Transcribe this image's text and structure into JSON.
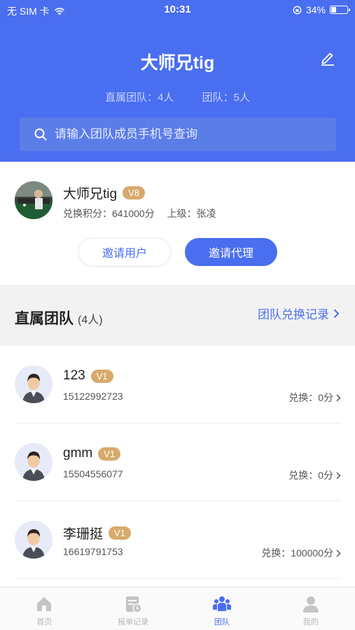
{
  "status_bar": {
    "carrier": "无 SIM 卡",
    "time": "10:31",
    "battery": "34%",
    "battery_level": 0.34
  },
  "header": {
    "title": "大师兄tig",
    "direct_team": "直属团队：4人",
    "team": "团队：5人"
  },
  "search": {
    "placeholder": "请输入团队成员手机号查询"
  },
  "profile": {
    "name": "大师兄tig",
    "level": "V8",
    "points": "兑换积分：641000分",
    "superior": "上级：张凌"
  },
  "actions": {
    "invite_user": "邀请用户",
    "invite_agent": "邀请代理"
  },
  "section": {
    "title": "直属团队",
    "count": "(4人)",
    "link": "团队兑换记录"
  },
  "members": [
    {
      "name": "123",
      "level": "V1",
      "phone": "15122992723",
      "points": "兑换：0分"
    },
    {
      "name": "gmm",
      "level": "V1",
      "phone": "15504556077",
      "points": "兑换：0分"
    },
    {
      "name": "李珊挺",
      "level": "V1",
      "phone": "16619791753",
      "points": "兑换：100000分"
    }
  ],
  "tabs": [
    {
      "label": "首页",
      "icon": "home-icon"
    },
    {
      "label": "报单记录",
      "icon": "orders-icon"
    },
    {
      "label": "团队",
      "icon": "team-icon",
      "active": true
    },
    {
      "label": "我的",
      "icon": "user-icon"
    }
  ],
  "colors": {
    "primary": "#4a6ef0",
    "badge": "#d7aa6b",
    "tab_inactive": "#b6b6b6"
  }
}
